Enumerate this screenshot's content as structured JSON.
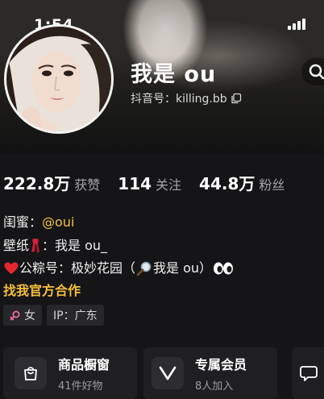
{
  "status_bar": {
    "time": "1:54"
  },
  "profile": {
    "name": "我是 ou",
    "douyin_id": "抖音号：killing.bb"
  },
  "stats": [
    {
      "num": "222.8",
      "unit": "万",
      "label": "获赞"
    },
    {
      "num": "114",
      "unit": "",
      "label": "关注"
    },
    {
      "num": "44.8",
      "unit": "万",
      "label": "粉丝"
    }
  ],
  "bio": {
    "line1_prefix": "闺蜜：",
    "line1_link": "@oui",
    "line2_prefix": "壁纸",
    "line2_text": "：我是 ou_",
    "line3_text": "公粽号：极妙花园（",
    "line3_end": "我是 ou）",
    "cta": "找我官方合作"
  },
  "tags": {
    "gender": "女",
    "ip": "IP：广东"
  },
  "cards": [
    {
      "title": "商品橱窗",
      "sub": "41件好物",
      "icon": "shop-bag-icon"
    },
    {
      "title": "专属会员",
      "sub": "8人加入",
      "icon": "vip-v-icon"
    }
  ],
  "colors": {
    "background": "#151517",
    "accent": "#f5c03c",
    "muted": "#a5a5a8"
  }
}
